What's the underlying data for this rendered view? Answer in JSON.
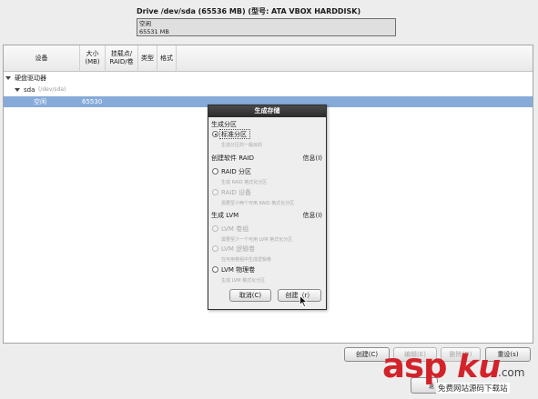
{
  "drive": {
    "title": "Drive /dev/sda (65536 MB) (型号: ATA VBOX HARDDISK)",
    "segment_label": "空闲",
    "segment_size": "65531 MB"
  },
  "table": {
    "columns": [
      "设备",
      "大小\n(MB)",
      "挂载点/\nRAID/卷",
      "类型",
      "格式"
    ],
    "group_label": "硬盘驱动器",
    "disk_name": "sda",
    "disk_path": "(/dev/sda)",
    "free_row": {
      "device": "空闲",
      "size": "65530"
    }
  },
  "buttons": {
    "create": "创建(C)",
    "edit": "编辑(E)",
    "delete": "删除(D)",
    "reset": "重设(s)",
    "back": "返"
  },
  "dialog": {
    "title": "生成存储",
    "section_partition": "生成分区",
    "std_partition": "标准分区",
    "std_partition_hint": "生成分区的一般目的",
    "section_raid": "创建软件 RAID",
    "raid_info": "信息(I)",
    "raid_partition": "RAID 分区",
    "raid_partition_hint": "生成 RAID 格式化分区",
    "raid_device": "RAID 设备",
    "raid_device_hint": "需要至少两个可用 RAID 格式化分区",
    "section_lvm": "生成 LVM",
    "lvm_info": "信息(I)",
    "lvm_vg": "LVM 卷组",
    "lvm_vg_hint": "需要至少一个可用 LVM 格式化分区",
    "lvm_lv": "LVM 逻辑卷",
    "lvm_lv_hint": "在可用卷组中生成逻辑卷",
    "lvm_pv": "LVM 物理卷",
    "lvm_pv_hint": "生成 LVM 格式化分区",
    "cancel": "取消(C)",
    "create": "创建（r）"
  },
  "watermark": {
    "asp": "asp",
    "ku": "ku",
    "com": ".com",
    "sub": "免费网站源码下载站"
  },
  "colors": {
    "selected_row": "#86abd9",
    "watermark_red": "#d2232a",
    "dialog_title": "#2a2a2a"
  }
}
